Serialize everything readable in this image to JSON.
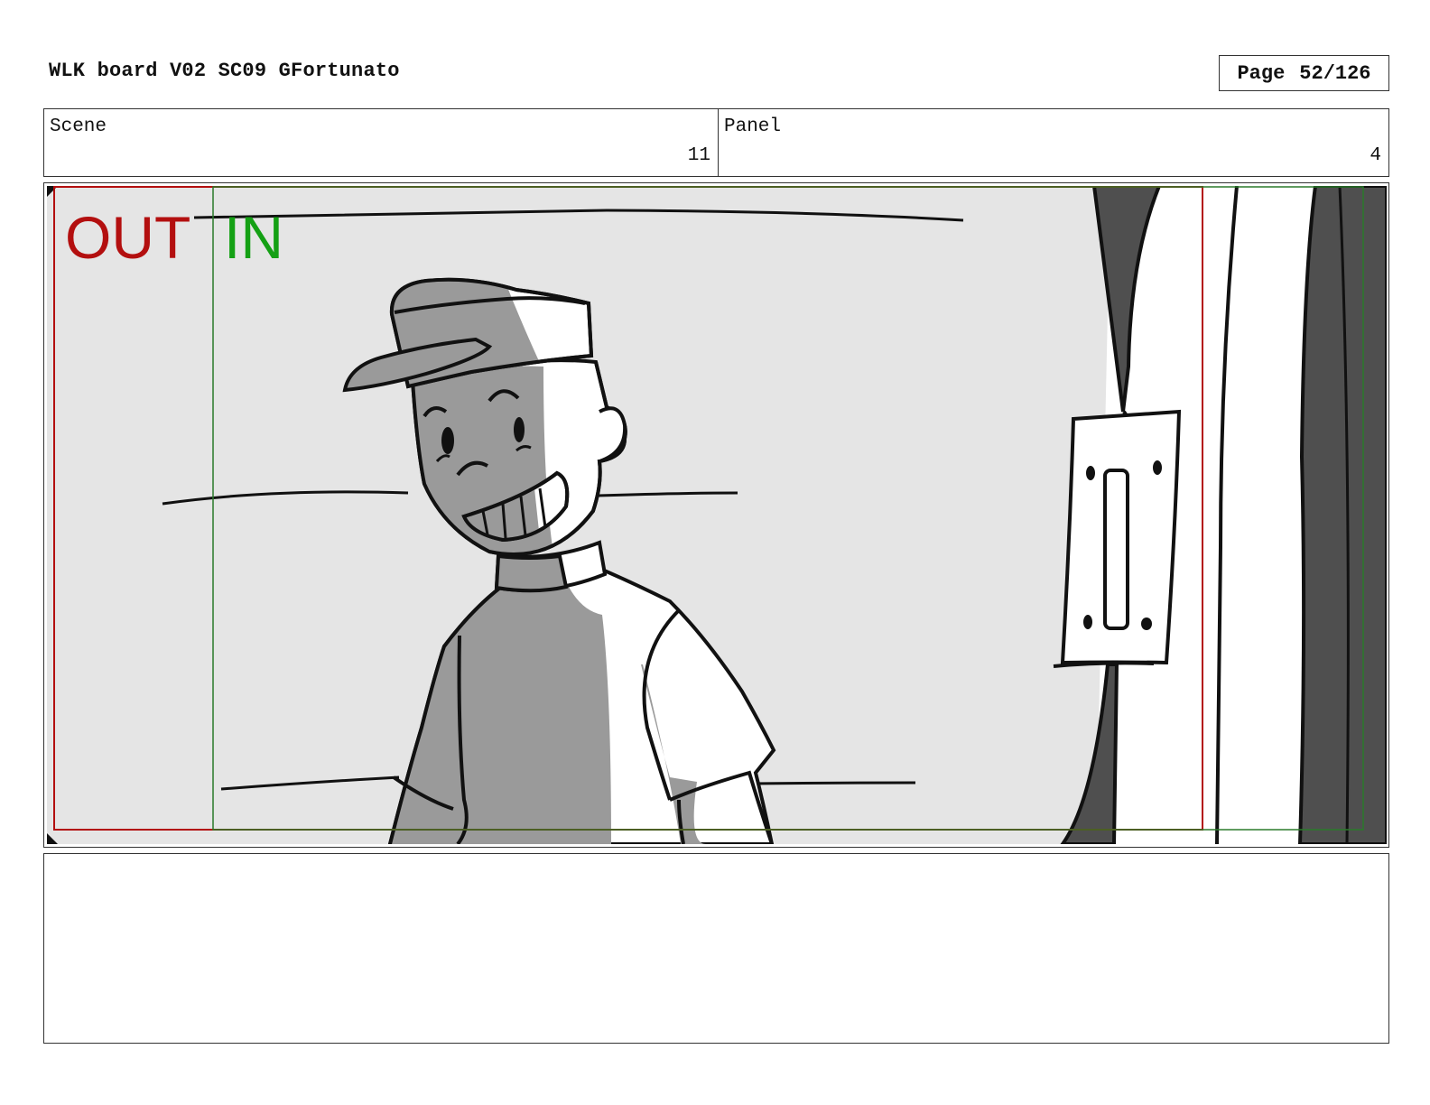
{
  "header": {
    "title": "WLK board V02 SC09 GFortunato",
    "page_label": "Page",
    "page_number": "52/126"
  },
  "info": {
    "scene_label": "Scene",
    "scene_value": "11",
    "panel_label": "Panel",
    "panel_value": "4"
  },
  "frame": {
    "out_label": "OUT",
    "in_label": "IN",
    "colors": {
      "out": "#b30f0f",
      "in": "#14a014",
      "background": "#e5e5e5",
      "shadow": "#9a9a9a",
      "dark": "#4f4f4f"
    }
  },
  "notes": {
    "text": ""
  }
}
